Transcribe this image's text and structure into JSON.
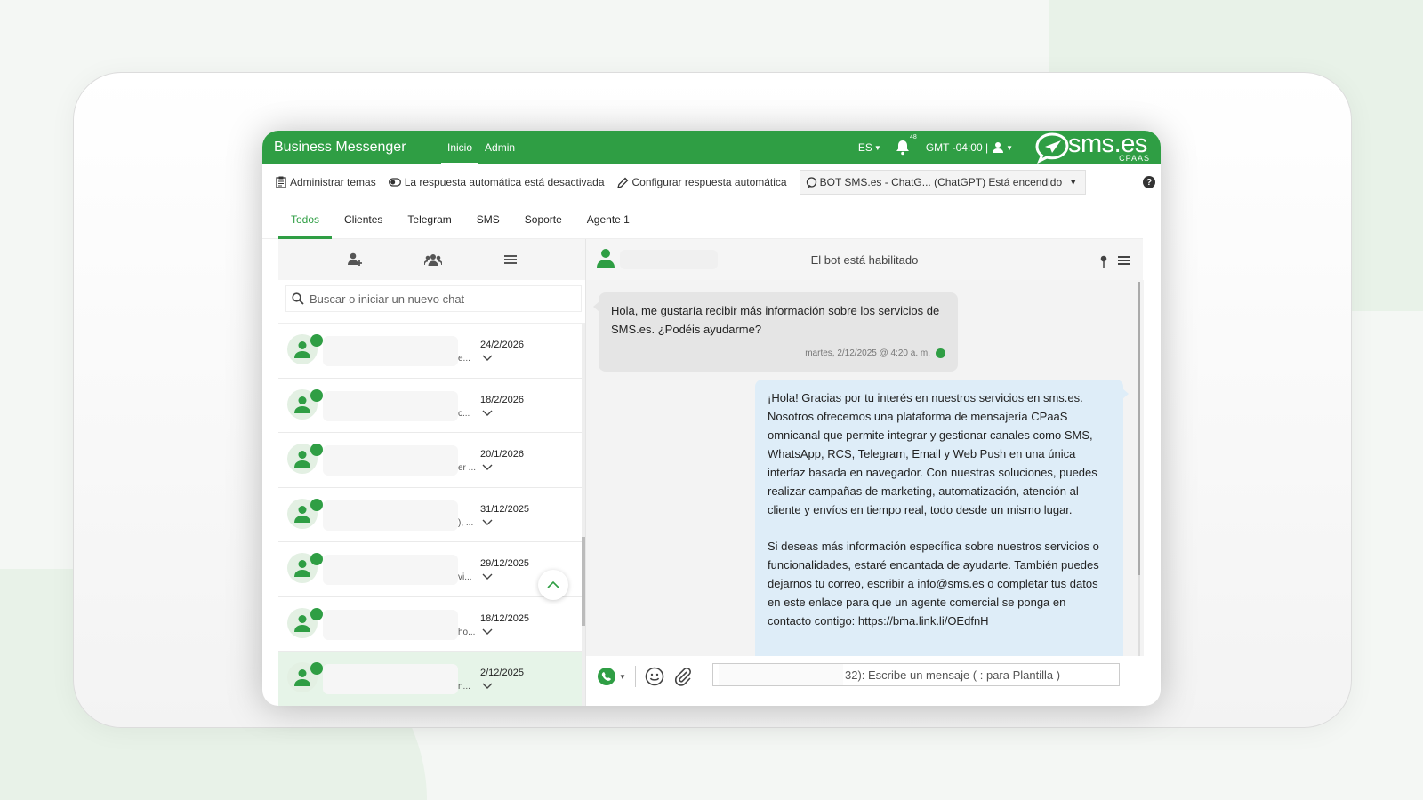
{
  "app": {
    "title": "Business Messenger",
    "nav": [
      "Inicio",
      "Admin"
    ],
    "language": "ES",
    "notifications": "48",
    "timezone": "GMT -04:00 |",
    "logo_text": "sms.es",
    "logo_sub": "CPAAS"
  },
  "toolbar": {
    "manage_topics": "Administrar temas",
    "auto_reply_status": "La respuesta automática está desactivada",
    "configure_auto_reply": "Configurar respuesta automática",
    "bot_select": "BOT SMS.es - ChatG... (ChatGPT) Está encendido",
    "help": "?"
  },
  "tabs": [
    "Todos",
    "Clientes",
    "Telegram",
    "SMS",
    "Soporte",
    "Agente 1"
  ],
  "sidebar": {
    "search_placeholder": "Buscar o iniciar un nuevo chat",
    "chats": [
      {
        "snippet": "e...",
        "date": "24/2/2026"
      },
      {
        "snippet": "c...",
        "date": "18/2/2026"
      },
      {
        "snippet": "er ...",
        "date": "20/1/2026"
      },
      {
        "snippet": "), ...",
        "date": "31/12/2025"
      },
      {
        "snippet": "vi...",
        "date": "29/12/2025"
      },
      {
        "snippet": "ho...",
        "date": "18/12/2025"
      },
      {
        "snippet": "n...",
        "date": "2/12/2025"
      }
    ]
  },
  "chat": {
    "bot_status": "El bot está habilitado",
    "incoming": {
      "text": "Hola, me gustaría recibir más información sobre los servicios de SMS.es. ¿Podéis ayudarme?",
      "timestamp": "martes, 2/12/2025 @ 4:20 a. m."
    },
    "outgoing": {
      "p1": "¡Hola! Gracias por tu interés en nuestros servicios en sms.es. Nosotros ofrecemos una plataforma de mensajería CPaaS omnicanal que permite integrar y gestionar canales como SMS, WhatsApp, RCS, Telegram, Email y Web Push en una única interfaz basada en navegador. Con nuestras soluciones, puedes realizar campañas de marketing, automatización, atención al cliente y envíos en tiempo real, todo desde un mismo lugar.",
      "p2": "Si deseas más información específica sobre nuestros servicios o funcionalidades, estaré encantada de ayudarte. También puedes dejarnos tu correo, escribir a info@sms.es o completar tus datos en este enlace para que un agente comercial se ponga en contacto contigo: https://bma.link.li/OEdfnH"
    },
    "input_placeholder": "32): Escribe un mensaje ( : para Plantilla )"
  },
  "colors": {
    "brand": "#2f9e44",
    "outgoing_bubble": "#deedf8",
    "incoming_bubble": "#e5e5e5"
  }
}
